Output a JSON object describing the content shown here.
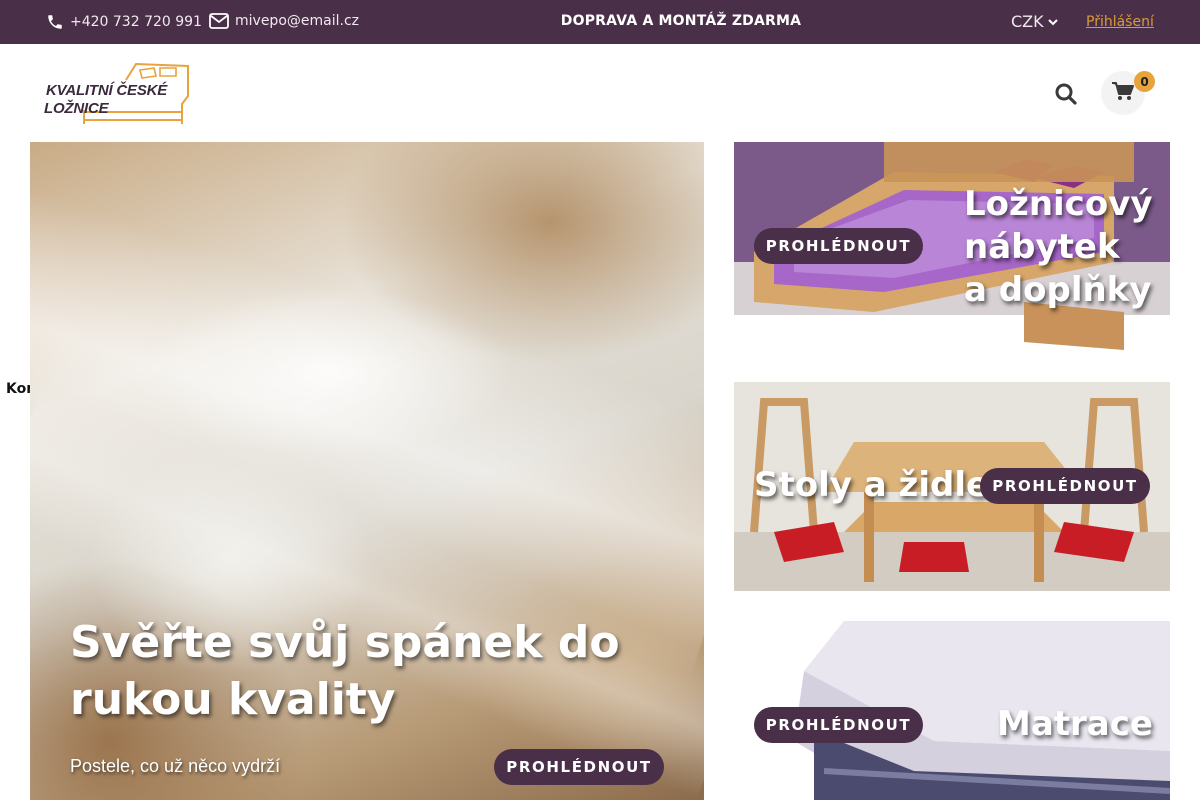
{
  "topbar": {
    "phone": "+420 732 720 991",
    "email": "mivepo@email.cz",
    "promo": "DOPRAVA A MONTÁŽ ZDARMA",
    "currency": "CZK",
    "login": "Přihlášení"
  },
  "header": {
    "logo_line1": "KVALITNÍ ČESKÉ",
    "logo_line2": "LOŽNICE",
    "cart_count": "0"
  },
  "side_tab": {
    "label": "Kontakt"
  },
  "hero": {
    "title": "Svěřte svůj spánek do rukou kvality",
    "subtitle": "Postele, co už něco vydrží",
    "button": "PROHLÉDNOUT"
  },
  "categories": [
    {
      "title_lines": [
        "Ložnicový",
        "nábytek",
        "a doplňky"
      ],
      "button": "PROHLÉDNOUT"
    },
    {
      "title": "Stoly a židle",
      "button": "PROHLÉDNOUT"
    },
    {
      "title": "Matrace",
      "button": "PROHLÉDNOUT"
    }
  ],
  "colors": {
    "brand_purple": "#4a2f48",
    "accent_orange": "#e8a33d",
    "login_link": "#d99a3c"
  },
  "icons": [
    "phone-icon",
    "mail-icon",
    "chevron-down-icon",
    "search-icon",
    "cart-icon"
  ]
}
